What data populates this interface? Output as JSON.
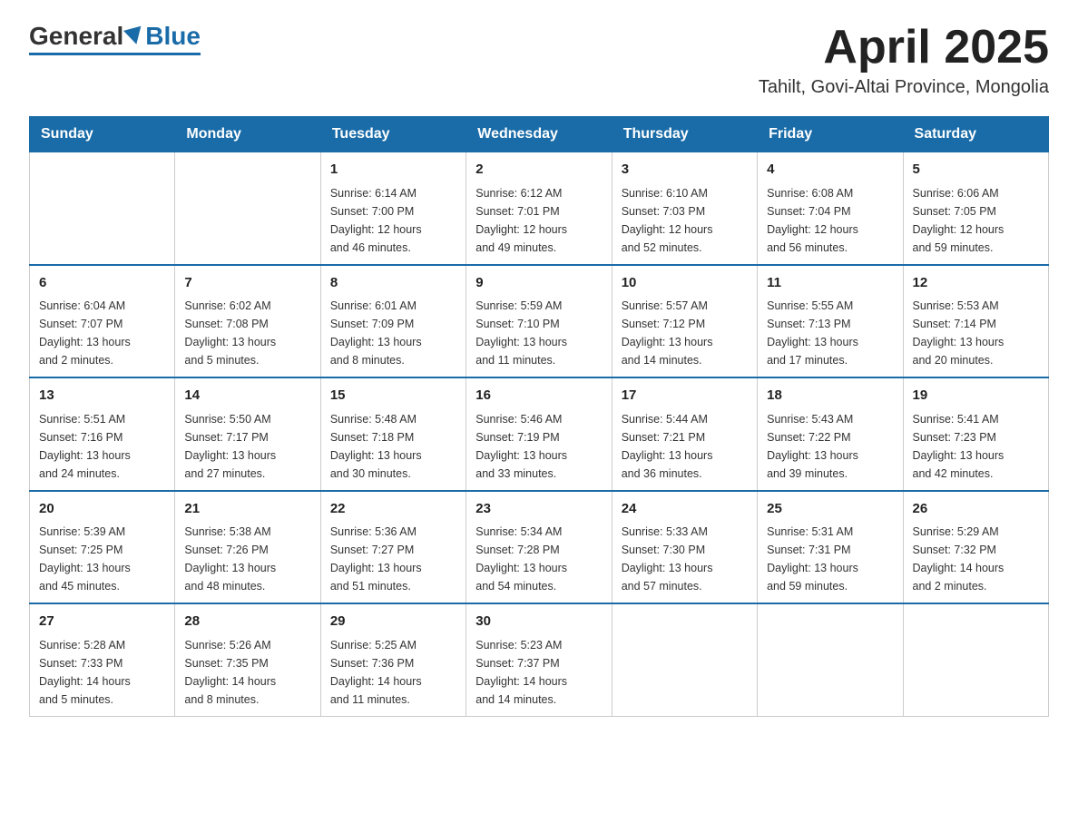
{
  "logo": {
    "general": "General",
    "blue": "Blue"
  },
  "title": "April 2025",
  "subtitle": "Tahilt, Govi-Altai Province, Mongolia",
  "headers": [
    "Sunday",
    "Monday",
    "Tuesday",
    "Wednesday",
    "Thursday",
    "Friday",
    "Saturday"
  ],
  "weeks": [
    [
      {
        "day": "",
        "info": ""
      },
      {
        "day": "",
        "info": ""
      },
      {
        "day": "1",
        "info": "Sunrise: 6:14 AM\nSunset: 7:00 PM\nDaylight: 12 hours\nand 46 minutes."
      },
      {
        "day": "2",
        "info": "Sunrise: 6:12 AM\nSunset: 7:01 PM\nDaylight: 12 hours\nand 49 minutes."
      },
      {
        "day": "3",
        "info": "Sunrise: 6:10 AM\nSunset: 7:03 PM\nDaylight: 12 hours\nand 52 minutes."
      },
      {
        "day": "4",
        "info": "Sunrise: 6:08 AM\nSunset: 7:04 PM\nDaylight: 12 hours\nand 56 minutes."
      },
      {
        "day": "5",
        "info": "Sunrise: 6:06 AM\nSunset: 7:05 PM\nDaylight: 12 hours\nand 59 minutes."
      }
    ],
    [
      {
        "day": "6",
        "info": "Sunrise: 6:04 AM\nSunset: 7:07 PM\nDaylight: 13 hours\nand 2 minutes."
      },
      {
        "day": "7",
        "info": "Sunrise: 6:02 AM\nSunset: 7:08 PM\nDaylight: 13 hours\nand 5 minutes."
      },
      {
        "day": "8",
        "info": "Sunrise: 6:01 AM\nSunset: 7:09 PM\nDaylight: 13 hours\nand 8 minutes."
      },
      {
        "day": "9",
        "info": "Sunrise: 5:59 AM\nSunset: 7:10 PM\nDaylight: 13 hours\nand 11 minutes."
      },
      {
        "day": "10",
        "info": "Sunrise: 5:57 AM\nSunset: 7:12 PM\nDaylight: 13 hours\nand 14 minutes."
      },
      {
        "day": "11",
        "info": "Sunrise: 5:55 AM\nSunset: 7:13 PM\nDaylight: 13 hours\nand 17 minutes."
      },
      {
        "day": "12",
        "info": "Sunrise: 5:53 AM\nSunset: 7:14 PM\nDaylight: 13 hours\nand 20 minutes."
      }
    ],
    [
      {
        "day": "13",
        "info": "Sunrise: 5:51 AM\nSunset: 7:16 PM\nDaylight: 13 hours\nand 24 minutes."
      },
      {
        "day": "14",
        "info": "Sunrise: 5:50 AM\nSunset: 7:17 PM\nDaylight: 13 hours\nand 27 minutes."
      },
      {
        "day": "15",
        "info": "Sunrise: 5:48 AM\nSunset: 7:18 PM\nDaylight: 13 hours\nand 30 minutes."
      },
      {
        "day": "16",
        "info": "Sunrise: 5:46 AM\nSunset: 7:19 PM\nDaylight: 13 hours\nand 33 minutes."
      },
      {
        "day": "17",
        "info": "Sunrise: 5:44 AM\nSunset: 7:21 PM\nDaylight: 13 hours\nand 36 minutes."
      },
      {
        "day": "18",
        "info": "Sunrise: 5:43 AM\nSunset: 7:22 PM\nDaylight: 13 hours\nand 39 minutes."
      },
      {
        "day": "19",
        "info": "Sunrise: 5:41 AM\nSunset: 7:23 PM\nDaylight: 13 hours\nand 42 minutes."
      }
    ],
    [
      {
        "day": "20",
        "info": "Sunrise: 5:39 AM\nSunset: 7:25 PM\nDaylight: 13 hours\nand 45 minutes."
      },
      {
        "day": "21",
        "info": "Sunrise: 5:38 AM\nSunset: 7:26 PM\nDaylight: 13 hours\nand 48 minutes."
      },
      {
        "day": "22",
        "info": "Sunrise: 5:36 AM\nSunset: 7:27 PM\nDaylight: 13 hours\nand 51 minutes."
      },
      {
        "day": "23",
        "info": "Sunrise: 5:34 AM\nSunset: 7:28 PM\nDaylight: 13 hours\nand 54 minutes."
      },
      {
        "day": "24",
        "info": "Sunrise: 5:33 AM\nSunset: 7:30 PM\nDaylight: 13 hours\nand 57 minutes."
      },
      {
        "day": "25",
        "info": "Sunrise: 5:31 AM\nSunset: 7:31 PM\nDaylight: 13 hours\nand 59 minutes."
      },
      {
        "day": "26",
        "info": "Sunrise: 5:29 AM\nSunset: 7:32 PM\nDaylight: 14 hours\nand 2 minutes."
      }
    ],
    [
      {
        "day": "27",
        "info": "Sunrise: 5:28 AM\nSunset: 7:33 PM\nDaylight: 14 hours\nand 5 minutes."
      },
      {
        "day": "28",
        "info": "Sunrise: 5:26 AM\nSunset: 7:35 PM\nDaylight: 14 hours\nand 8 minutes."
      },
      {
        "day": "29",
        "info": "Sunrise: 5:25 AM\nSunset: 7:36 PM\nDaylight: 14 hours\nand 11 minutes."
      },
      {
        "day": "30",
        "info": "Sunrise: 5:23 AM\nSunset: 7:37 PM\nDaylight: 14 hours\nand 14 minutes."
      },
      {
        "day": "",
        "info": ""
      },
      {
        "day": "",
        "info": ""
      },
      {
        "day": "",
        "info": ""
      }
    ]
  ]
}
